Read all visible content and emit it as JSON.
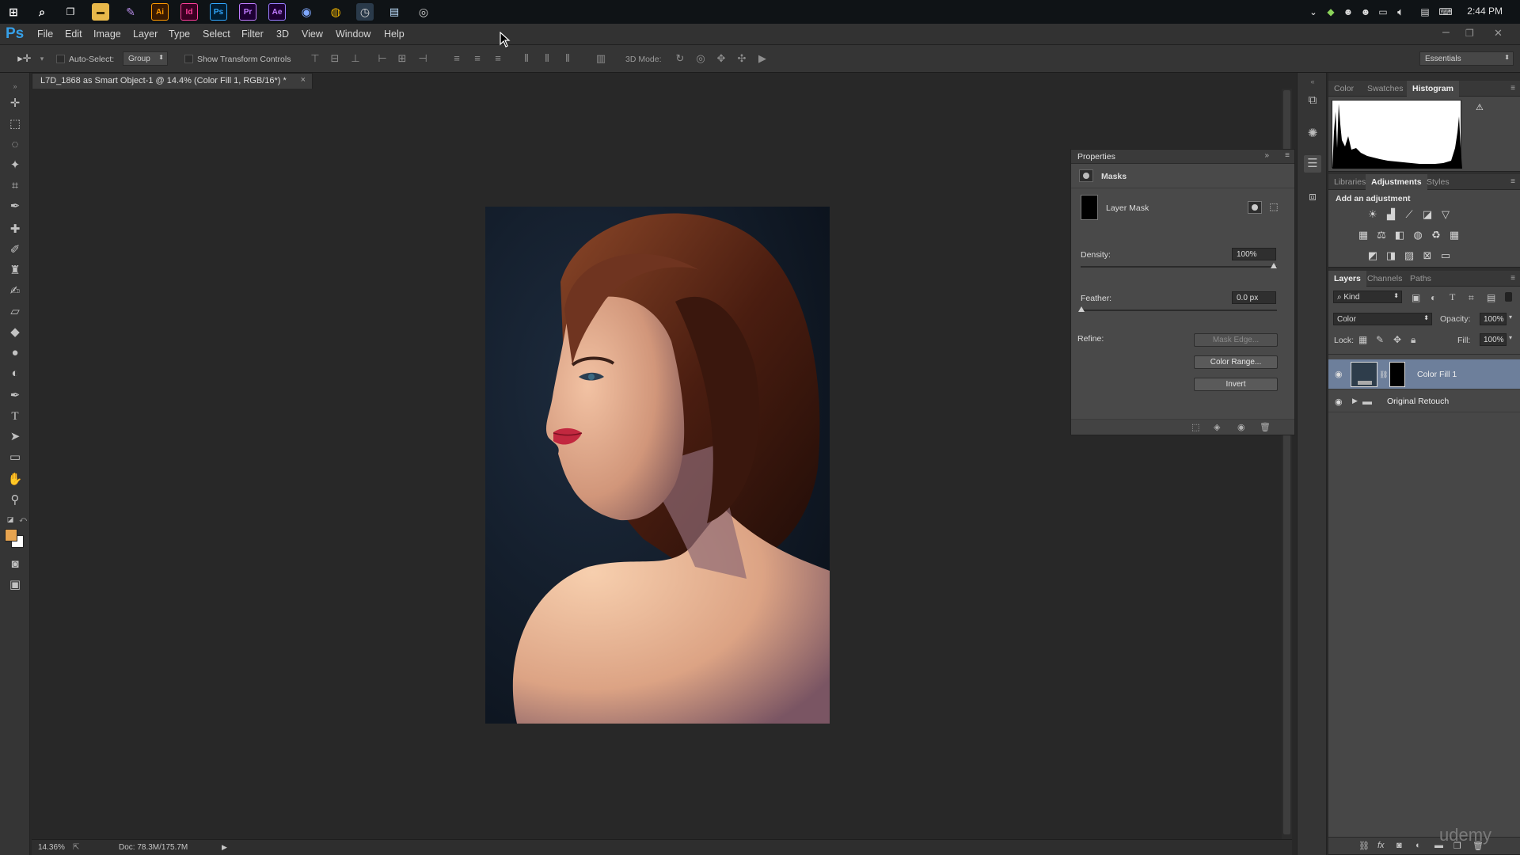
{
  "taskbar": {
    "clock": "2:44 PM",
    "icons": [
      "windows-logo",
      "search",
      "task-view",
      "file-explorer",
      "pen",
      "Ai",
      "Id",
      "Ps",
      "Pr",
      "Ae",
      "circle-app",
      "chrome",
      "clock-app",
      "notes-app",
      "camera-app"
    ]
  },
  "menubar": {
    "logo": "Ps",
    "items": [
      "File",
      "Edit",
      "Image",
      "Layer",
      "Type",
      "Select",
      "Filter",
      "3D",
      "View",
      "Window",
      "Help"
    ]
  },
  "options": {
    "auto_select_label": "Auto-Select:",
    "auto_select_value": "Group",
    "show_transform_label": "Show Transform Controls",
    "mode_3d_label": "3D Mode:",
    "workspace": "Essentials"
  },
  "document": {
    "tab_title": "L7D_1868 as Smart Object-1 @ 14.4% (Color Fill 1, RGB/16*) *",
    "close_glyph": "×",
    "zoom": "14.36%",
    "doc_size": "Doc: 78.3M/175.7M"
  },
  "properties": {
    "title": "Properties",
    "section": "Masks",
    "mask_type": "Layer Mask",
    "density_label": "Density:",
    "density_value": "100%",
    "feather_label": "Feather:",
    "feather_value": "0.0 px",
    "refine_label": "Refine:",
    "mask_edge_btn": "Mask Edge...",
    "color_range_btn": "Color Range...",
    "invert_btn": "Invert"
  },
  "right_panels": {
    "top_tabs": [
      "Color",
      "Swatches",
      "Histogram"
    ],
    "mid_tabs": [
      "Libraries",
      "Adjustments",
      "Styles"
    ],
    "add_adjustment": "Add an adjustment",
    "layer_tabs": [
      "Layers",
      "Channels",
      "Paths"
    ],
    "kind_filter": "Kind",
    "blend_mode": "Color",
    "opacity_label": "Opacity:",
    "opacity_value": "100%",
    "lock_label": "Lock:",
    "fill_label": "Fill:",
    "fill_value": "100%",
    "layers": [
      {
        "name": "Color Fill 1",
        "selected": true
      },
      {
        "name": "Original Retouch",
        "selected": false
      }
    ]
  },
  "watermark": "udemy",
  "colors": {
    "accent": "#36a0e8",
    "foreground_swatch": "#e7a450",
    "background_swatch": "#ffffff",
    "selected_layer": "#6d7f9b"
  }
}
